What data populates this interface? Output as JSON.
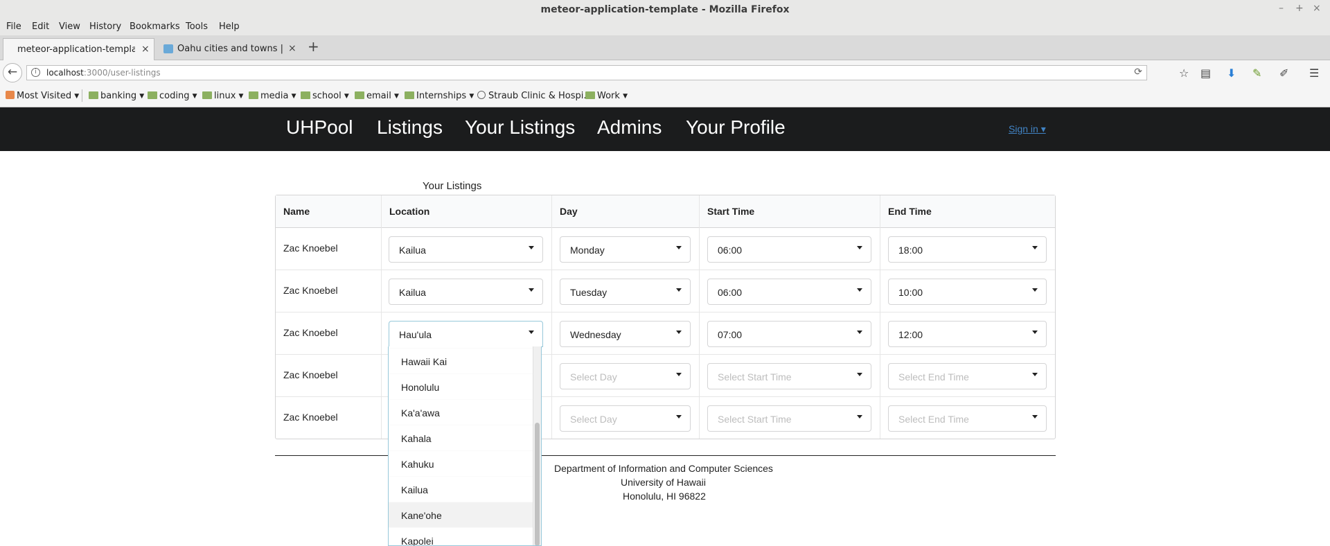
{
  "window": {
    "title": "meteor-application-template - Mozilla Firefox",
    "minimize": "–",
    "maximize": "+",
    "close": "×"
  },
  "menubar": [
    "File",
    "Edit",
    "View",
    "History",
    "Bookmarks",
    "Tools",
    "Help"
  ],
  "tabs": [
    {
      "label": "meteor-application-template",
      "close": "×"
    },
    {
      "label": "Oahu cities and towns | T...",
      "close": "×"
    }
  ],
  "new_tab": "+",
  "address": {
    "host": "localhost",
    "path": ":3000/user-listings"
  },
  "bookmarks": [
    {
      "label": "Most Visited",
      "icon": "most-visited-icon"
    },
    {
      "label": "banking",
      "icon": "folder-icon"
    },
    {
      "label": "coding",
      "icon": "folder-icon"
    },
    {
      "label": "linux",
      "icon": "folder-icon"
    },
    {
      "label": "media",
      "icon": "folder-icon"
    },
    {
      "label": "school",
      "icon": "folder-icon"
    },
    {
      "label": "email",
      "icon": "folder-icon"
    },
    {
      "label": "Internships",
      "icon": "folder-icon"
    },
    {
      "label": "Straub Clinic & Hospi...",
      "icon": "globe-icon"
    },
    {
      "label": "Work",
      "icon": "folder-icon"
    }
  ],
  "site_nav": {
    "brand": "UHPool",
    "links": [
      "Listings",
      "Your Listings",
      "Admins",
      "Your Profile"
    ],
    "signin": "Sign in ▾"
  },
  "page": {
    "heading": "Your Listings",
    "columns": [
      "Name",
      "Location",
      "Day",
      "Start Time",
      "End Time"
    ],
    "rows": [
      {
        "name": "Zac Knoebel",
        "location": "Kailua",
        "day": "Monday",
        "start": "06:00",
        "end": "18:00"
      },
      {
        "name": "Zac Knoebel",
        "location": "Kailua",
        "day": "Tuesday",
        "start": "06:00",
        "end": "10:00"
      },
      {
        "name": "Zac Knoebel",
        "location": "Hau'ula",
        "day": "Wednesday",
        "start": "07:00",
        "end": "12:00"
      },
      {
        "name": "Zac Knoebel",
        "location": "",
        "day": "Select Day",
        "start": "Select Start Time",
        "end": "Select End Time"
      },
      {
        "name": "Zac Knoebel",
        "location": "",
        "day": "Select Day",
        "start": "Select Start Time",
        "end": "Select End Time"
      }
    ],
    "location_options": [
      "Hawaii Kai",
      "Honolulu",
      "Ka'a'awa",
      "Kahala",
      "Kahuku",
      "Kailua",
      "Kane'ohe",
      "Kapolei"
    ],
    "hovered_option": "Kane'ohe"
  },
  "footer": {
    "line1": "Department of Information and Computer Sciences",
    "line2": "University of Hawaii",
    "line3": "Honolulu, HI 96822"
  },
  "colors": {
    "nav_bg": "#1b1c1d",
    "link": "#4183c4",
    "dropdown_focus": "#96c8da"
  }
}
